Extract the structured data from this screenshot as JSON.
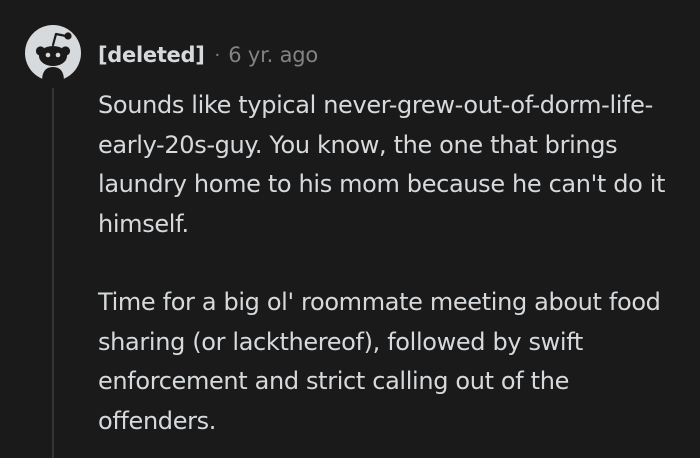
{
  "comment": {
    "author": "[deleted]",
    "separator": "·",
    "time": "6 yr. ago",
    "avatar_icon": "reddit-snoo-avatar-icon",
    "paragraphs": [
      "Sounds like typical never-grew-out-of-dorm-life-early-20s-guy. You know, the one that brings laundry home to his mom because he can't do it himself.",
      "Time for a big ol' roommate meeting about food sharing (or lackthereof), followed by swift enforcement and strict calling out of the offenders."
    ]
  },
  "colors": {
    "background": "#1a1a1b",
    "text": "#d7dadc",
    "meta": "#818384",
    "avatar_bg": "#d7dadc",
    "avatar_fg": "#1a1a1b",
    "thread_line": "#343536"
  }
}
